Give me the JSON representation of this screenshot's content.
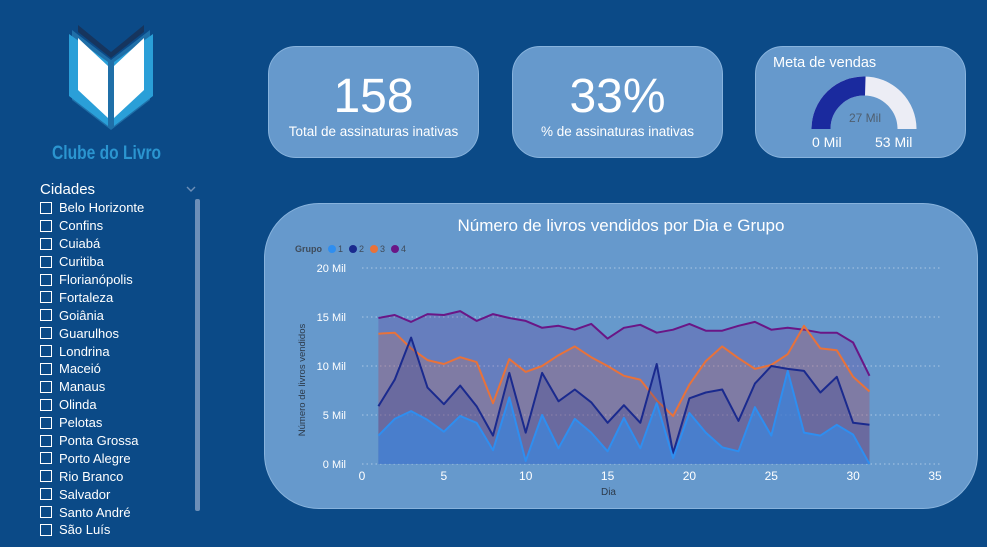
{
  "logo": {
    "text": "Clube do Livro"
  },
  "slicer": {
    "title": "Cidades",
    "items": [
      "Belo Horizonte",
      "Confins",
      "Cuiabá",
      "Curitiba",
      "Florianópolis",
      "Fortaleza",
      "Goiânia",
      "Guarulhos",
      "Londrina",
      "Maceió",
      "Manaus",
      "Olinda",
      "Pelotas",
      "Ponta Grossa",
      "Porto Alegre",
      "Rio Branco",
      "Salvador",
      "Santo André",
      "São Luís"
    ]
  },
  "cards": {
    "total": {
      "value": "158",
      "label": "Total de assinaturas inativas"
    },
    "pct": {
      "value": "33%",
      "label": "% de assinaturas inativas"
    }
  },
  "gauge": {
    "title": "Meta de vendas",
    "center_label": "27 Mil",
    "min_label": "0 Mil",
    "max_label": "53 Mil",
    "value": 27,
    "min": 0,
    "max": 53,
    "fill_color": "#1a2a9e",
    "track_color": "#ecedf5"
  },
  "chart_data": {
    "type": "area",
    "title": "Número de livros vendidos por Dia e Grupo",
    "xlabel": "Dia",
    "ylabel": "Número de livros vendidos",
    "legend_title": "Grupo",
    "legend_position": "top-left",
    "xlim": [
      0,
      35
    ],
    "ylim": [
      0,
      20000
    ],
    "x_ticks": [
      "0",
      "5",
      "10",
      "15",
      "20",
      "25",
      "30",
      "35"
    ],
    "y_ticks": [
      "0 Mil",
      "5 Mil",
      "10 Mil",
      "15 Mil",
      "20 Mil"
    ],
    "grid": true,
    "x": [
      1,
      2,
      3,
      4,
      5,
      6,
      7,
      8,
      9,
      10,
      11,
      12,
      13,
      14,
      15,
      16,
      17,
      18,
      19,
      20,
      21,
      22,
      23,
      24,
      25,
      26,
      27,
      28,
      29,
      30,
      31
    ],
    "series": [
      {
        "name": "1",
        "color": "#2e8ef0",
        "values": [
          2900,
          4600,
          5400,
          4500,
          3300,
          4900,
          4200,
          1400,
          6800,
          300,
          5000,
          1600,
          4600,
          3200,
          1300,
          4700,
          1600,
          6200,
          600,
          5200,
          3200,
          1700,
          1300,
          5800,
          2900,
          9500,
          3200,
          2900,
          4000,
          3000,
          0
        ]
      },
      {
        "name": "2",
        "color": "#1a2a8e",
        "values": [
          5900,
          8600,
          12900,
          7800,
          6100,
          8000,
          5900,
          2900,
          9300,
          3200,
          9300,
          6400,
          7600,
          6300,
          4200,
          6000,
          4200,
          10200,
          1100,
          6700,
          7300,
          7600,
          4400,
          8200,
          10000,
          9700,
          9500,
          7300,
          8900,
          4200,
          4000
        ]
      },
      {
        "name": "3",
        "color": "#e8723a",
        "values": [
          13300,
          13400,
          11800,
          10600,
          10200,
          10900,
          10400,
          6200,
          10700,
          9400,
          10000,
          11100,
          12000,
          10900,
          10000,
          9000,
          8600,
          6500,
          4900,
          8100,
          10500,
          12000,
          10800,
          9700,
          10100,
          11200,
          14100,
          11800,
          11600,
          8900,
          7400
        ]
      },
      {
        "name": "4",
        "color": "#6a1686",
        "values": [
          14900,
          15200,
          14500,
          15300,
          15200,
          15600,
          14600,
          15300,
          14900,
          14600,
          13900,
          14100,
          13700,
          14300,
          12800,
          13900,
          14200,
          13400,
          13700,
          14300,
          13600,
          13600,
          14100,
          14500,
          13700,
          13900,
          13700,
          13400,
          13400,
          12400,
          9000
        ]
      }
    ]
  }
}
